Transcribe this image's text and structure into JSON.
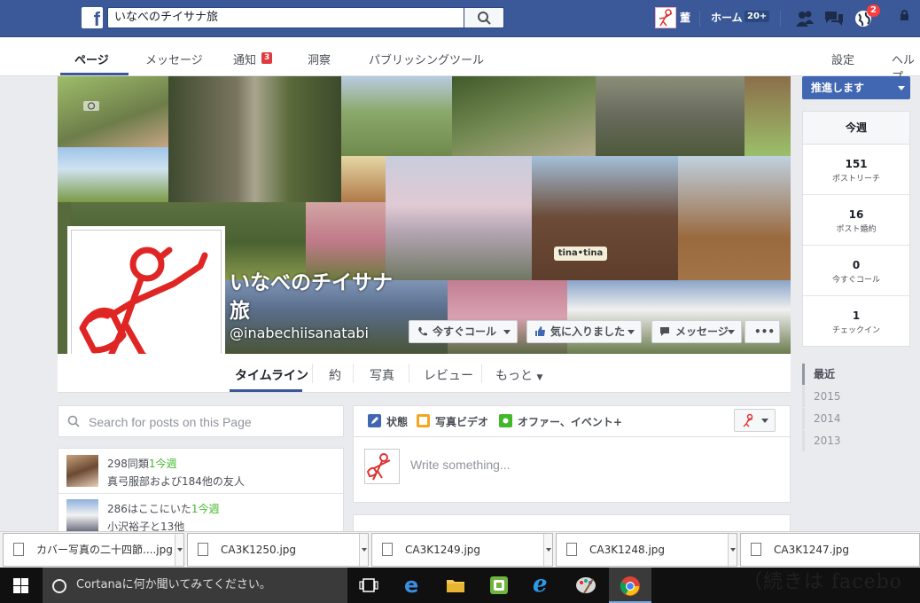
{
  "topbar": {
    "search_value": "いなべのチイサナ旅",
    "username": "董",
    "home_label": "ホーム",
    "home_count": "20+",
    "notifications_count": "2"
  },
  "page_nav": {
    "tabs": [
      "ページ",
      "メッセージ",
      "通知",
      "洞察",
      "パブリッシングツール"
    ],
    "notif_badge": "3",
    "settings": "設定",
    "help": "ヘルプ"
  },
  "cover": {
    "title": "いなべのチイサナ旅",
    "handle": "@inabechiisanatabi",
    "call_button": "今すぐコール",
    "like_button": "気に入りました",
    "message_button": "メッセージ",
    "more_button": "•••",
    "sign_text": "tina•tina"
  },
  "timeline_tabs": [
    "タイムライン",
    "約",
    "写真",
    "レビュー",
    "もっと"
  ],
  "right_column": {
    "recommend_label": "推進します",
    "stats_header": "今週",
    "stats": [
      {
        "value": "151",
        "label": "ポストリーチ"
      },
      {
        "value": "16",
        "label": "ポスト婚約"
      },
      {
        "value": "0",
        "label": "今すぐコール"
      },
      {
        "value": "1",
        "label": "チェックイン"
      }
    ],
    "years": [
      "最近",
      "2015",
      "2014",
      "2013"
    ]
  },
  "left_column": {
    "search_placeholder": "Search for posts on this Page",
    "friends": [
      {
        "main": "298同類",
        "highlight": "1今週",
        "sub": "真弓服部および184他の友人"
      },
      {
        "main": "286はここにいた",
        "highlight": "1今週",
        "sub": "小沢裕子と13他"
      }
    ]
  },
  "composer": {
    "tabs": [
      "状態",
      "写真ビデオ",
      "オファー、イベント+"
    ],
    "placeholder": "Write something..."
  },
  "downloads": [
    "カバー写真の二十四節....jpg",
    "CA3K1250.jpg",
    "CA3K1249.jpg",
    "CA3K1248.jpg",
    "CA3K1247.jpg"
  ],
  "taskbar": {
    "cortana_placeholder": "Cortanaに何か聞いてみてください。",
    "background_text": "（続きは facebo"
  },
  "colors": {
    "brand_blue": "#3b5998",
    "badge_red": "#fa3e3e",
    "green": "#42b72a"
  }
}
